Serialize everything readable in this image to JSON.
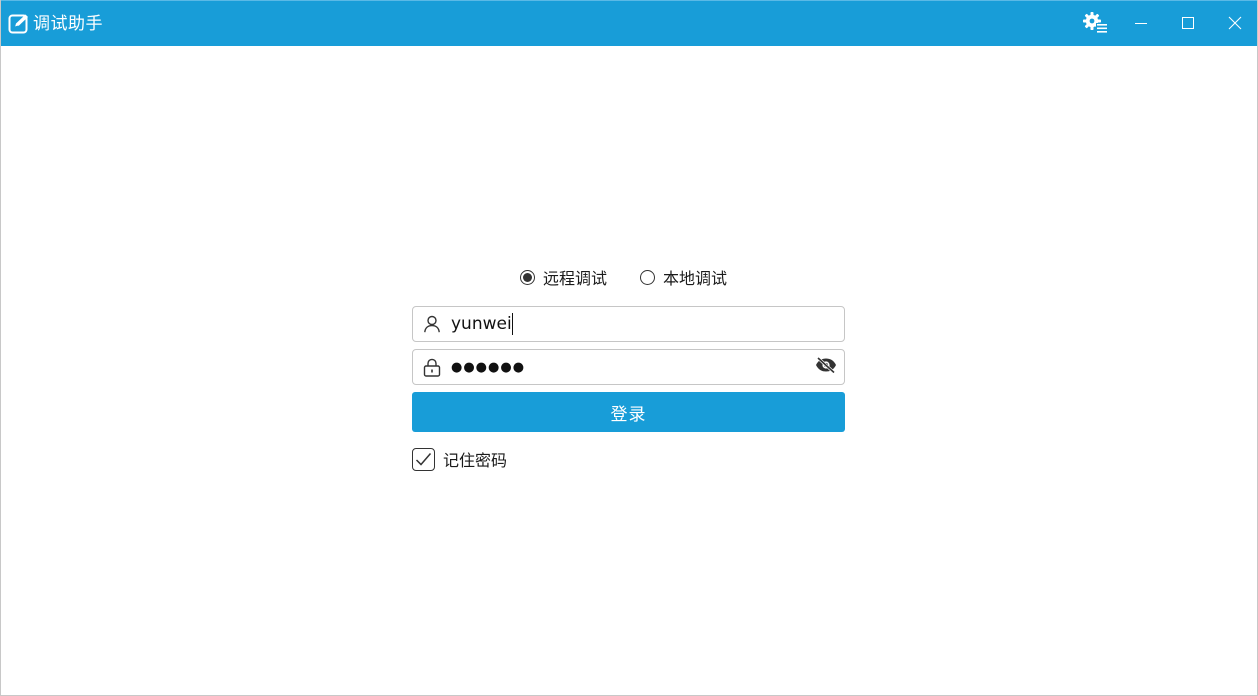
{
  "window": {
    "title": "调试助手"
  },
  "colors": {
    "accent": "#189dd8",
    "text": "#1a1a1a",
    "border": "#c6c6c6"
  },
  "titlebar": {
    "icons": [
      "app-edit-icon",
      "settings-gear-icon",
      "minimize-icon",
      "maximize-icon",
      "close-icon"
    ]
  },
  "login": {
    "modes": [
      {
        "label": "远程调试",
        "checked": true
      },
      {
        "label": "本地调试",
        "checked": false
      }
    ],
    "username": {
      "value": "yunwei",
      "icon": "user-icon"
    },
    "password": {
      "masked": "●●●●●●",
      "icon": "lock-icon",
      "toggle_icon": "eye-slash-icon"
    },
    "submit_label": "登录",
    "remember": {
      "label": "记住密码",
      "checked": true
    }
  }
}
